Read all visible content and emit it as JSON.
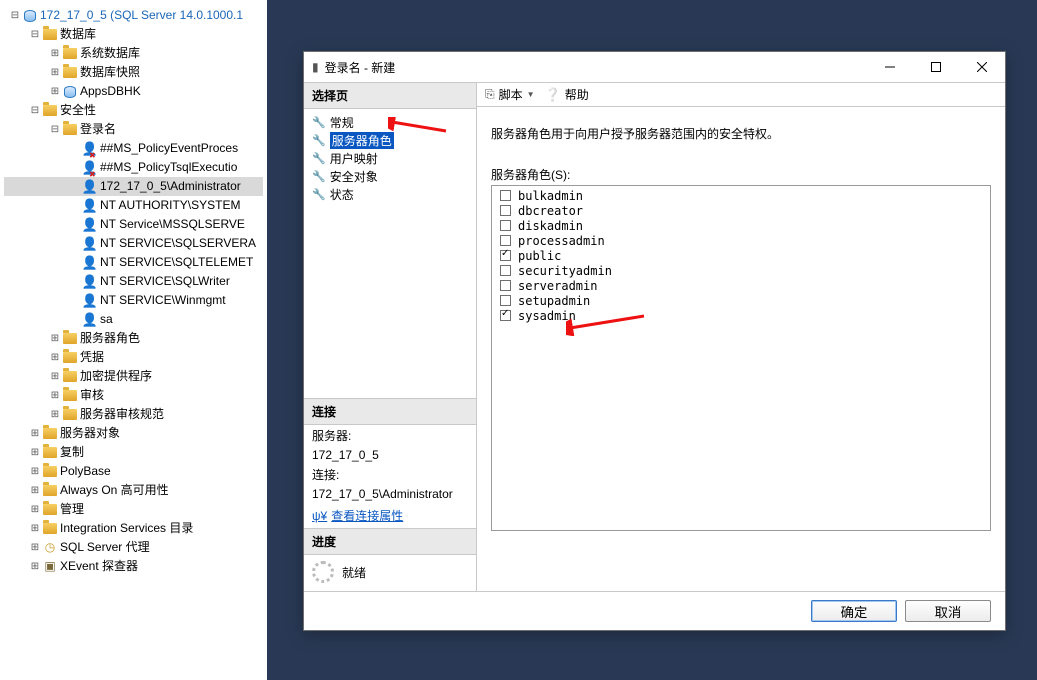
{
  "tree": {
    "root": "172_17_0_5 (SQL Server 14.0.1000.1",
    "db_group": "数据库",
    "sysdb": "系统数据库",
    "snapshot": "数据库快照",
    "appsdb": "AppsDBHK",
    "security": "安全性",
    "logins": "登录名",
    "u_policyevent": "##MS_PolicyEventProces",
    "u_policytsql": "##MS_PolicyTsqlExecutio",
    "u_admin": "172_17_0_5\\Administrator",
    "u_ntauth": "NT AUTHORITY\\SYSTEM",
    "u_mssql": "NT Service\\MSSQLSERVE",
    "u_sqlagent": "NT SERVICE\\SQLSERVERA",
    "u_telemetry": "NT SERVICE\\SQLTELEMET",
    "u_writer": "NT SERVICE\\SQLWriter",
    "u_winmgmt": "NT SERVICE\\Winmgmt",
    "u_sa": "sa",
    "server_roles": "服务器角色",
    "credentials": "凭据",
    "crypto": "加密提供程序",
    "audit": "审核",
    "audit_spec": "服务器审核规范",
    "server_objects": "服务器对象",
    "replication": "复制",
    "polybase": "PolyBase",
    "alwayson": "Always On 高可用性",
    "management": "管理",
    "integration": "Integration Services 目录",
    "agent": "SQL Server 代理",
    "xevent": "XEvent 探查器"
  },
  "dialog": {
    "title": "登录名 - 新建",
    "select_page": "选择页",
    "pages": {
      "general": "常规",
      "server_roles": "服务器角色",
      "user_mapping": "用户映射",
      "securables": "安全对象",
      "status": "状态"
    },
    "connection_head": "连接",
    "server_label": "服务器:",
    "server_value": "172_17_0_5",
    "conn_label": "连接:",
    "conn_value": "172_17_0_5\\Administrator",
    "view_props": "查看连接属性",
    "progress_head": "进度",
    "progress_ready": "就绪",
    "script": "脚本",
    "help": "帮助",
    "description": "服务器角色用于向用户授予服务器范围内的安全特权。",
    "roles_label": "服务器角色(S):",
    "roles": [
      {
        "name": "bulkadmin",
        "checked": false
      },
      {
        "name": "dbcreator",
        "checked": false
      },
      {
        "name": "diskadmin",
        "checked": false
      },
      {
        "name": "processadmin",
        "checked": false
      },
      {
        "name": "public",
        "checked": true
      },
      {
        "name": "securityadmin",
        "checked": false
      },
      {
        "name": "serveradmin",
        "checked": false
      },
      {
        "name": "setupadmin",
        "checked": false
      },
      {
        "name": "sysadmin",
        "checked": true
      }
    ],
    "ok": "确定",
    "cancel": "取消"
  }
}
